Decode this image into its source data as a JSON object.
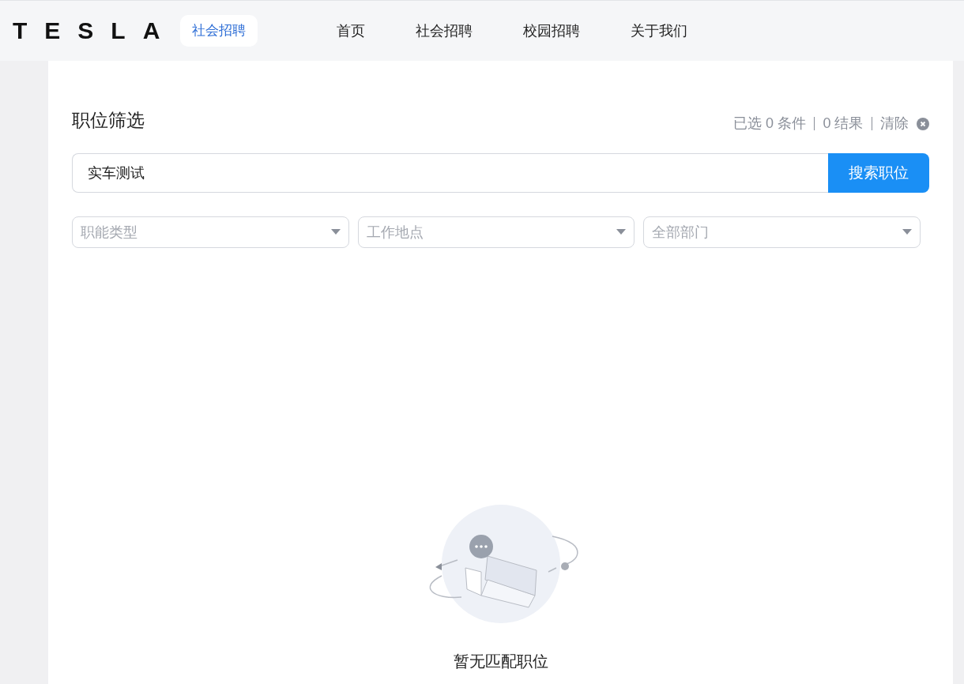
{
  "header": {
    "logo": "TESLA",
    "section_badge": "社会招聘",
    "nav": [
      {
        "label": "首页",
        "selected": false
      },
      {
        "label": "社会招聘",
        "selected": false
      },
      {
        "label": "校园招聘",
        "selected": false
      },
      {
        "label": "关于我们",
        "selected": false
      }
    ]
  },
  "filter": {
    "title": "职位筛选",
    "summary": [
      "已选 0 条件",
      "0 结果"
    ],
    "clear": "清除",
    "search_value": "实车测试",
    "search_button": "搜索职位",
    "selects": [
      {
        "placeholder": "职能类型"
      },
      {
        "placeholder": "工作地点"
      },
      {
        "placeholder": "全部部门"
      }
    ]
  },
  "empty_state": {
    "message": "暂无匹配职位"
  }
}
